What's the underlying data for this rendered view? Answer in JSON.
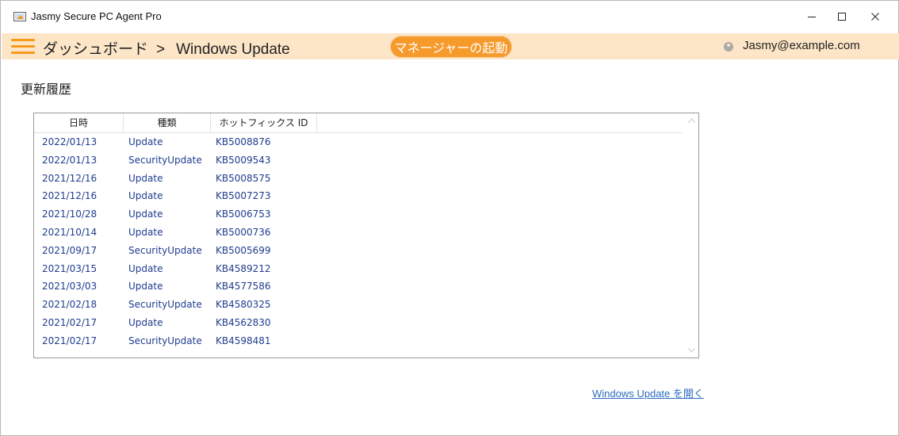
{
  "window": {
    "title": "Jasmy Secure PC Agent Pro",
    "controls": {
      "minimize": "—",
      "maximize": "☐",
      "close": "✕"
    }
  },
  "header": {
    "breadcrumb_root": "ダッシュボード",
    "breadcrumb_sep": ">",
    "breadcrumb_current": "Windows Update",
    "manager_button": "マネージャーの起動",
    "user_email": "Jasmy@example.com",
    "accent_color": "#f79a2c",
    "band_color": "#fde5c7"
  },
  "main": {
    "section_title": "更新履歴",
    "columns": [
      "日時",
      "種類",
      "ホットフィックス ID"
    ],
    "rows": [
      {
        "date": "2022/01/13",
        "type": "Update",
        "id": "KB5008876"
      },
      {
        "date": "2022/01/13",
        "type": "SecurityUpdate",
        "id": "KB5009543"
      },
      {
        "date": "2021/12/16",
        "type": "Update",
        "id": "KB5008575"
      },
      {
        "date": "2021/12/16",
        "type": "Update",
        "id": "KB5007273"
      },
      {
        "date": "2021/10/28",
        "type": "Update",
        "id": "KB5006753"
      },
      {
        "date": "2021/10/14",
        "type": "Update",
        "id": "KB5000736"
      },
      {
        "date": "2021/09/17",
        "type": "SecurityUpdate",
        "id": "KB5005699"
      },
      {
        "date": "2021/03/15",
        "type": "Update",
        "id": "KB4589212"
      },
      {
        "date": "2021/03/03",
        "type": "Update",
        "id": "KB4577586"
      },
      {
        "date": "2021/02/18",
        "type": "SecurityUpdate",
        "id": "KB4580325"
      },
      {
        "date": "2021/02/17",
        "type": "Update",
        "id": "KB4562830"
      },
      {
        "date": "2021/02/17",
        "type": "SecurityUpdate",
        "id": "KB4598481"
      }
    ],
    "open_link": "Windows Update を開く"
  }
}
